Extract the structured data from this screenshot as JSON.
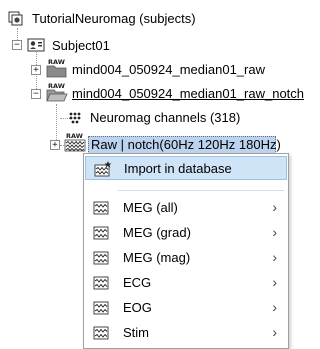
{
  "tree": {
    "root": {
      "label": "TutorialNeuromag (subjects)",
      "icon": "protocol-icon"
    },
    "subject": {
      "label": "Subject01",
      "expander": "−",
      "icon": "subject-icon"
    },
    "runs": [
      {
        "label": "mind004_050924_median01_raw",
        "expander": "+",
        "icon": "raw-folder-icon"
      },
      {
        "label": "mind004_050924_median01_raw_notch",
        "expander": "−",
        "icon": "raw-folder-open-icon"
      }
    ],
    "channels": {
      "label": "Neuromag channels (318)",
      "icon": "channel-icon"
    },
    "selected": {
      "label": "Raw | notch(60Hz 120Hz 180Hz)",
      "expander": "+",
      "icon": "raw-data-icon"
    },
    "icon_tag": "RAW"
  },
  "menu": {
    "items": [
      {
        "label": "Import in database",
        "icon": "import-icon",
        "submenu": false
      },
      {
        "label": "MEG (all)",
        "icon": "display-icon",
        "submenu": true,
        "arrow": "›"
      },
      {
        "label": "MEG (grad)",
        "icon": "display-icon",
        "submenu": true,
        "arrow": "›"
      },
      {
        "label": "MEG (mag)",
        "icon": "display-icon",
        "submenu": true,
        "arrow": "›"
      },
      {
        "label": "ECG",
        "icon": "display-icon",
        "submenu": true,
        "arrow": "›"
      },
      {
        "label": "EOG",
        "icon": "display-icon",
        "submenu": true,
        "arrow": "›"
      },
      {
        "label": "Stim",
        "icon": "display-icon",
        "submenu": true,
        "arrow": "›"
      }
    ]
  },
  "colors": {
    "selection": "#bcd3ef",
    "menu_hover": "#cfe4f7",
    "folder": "#7a7a7a"
  }
}
